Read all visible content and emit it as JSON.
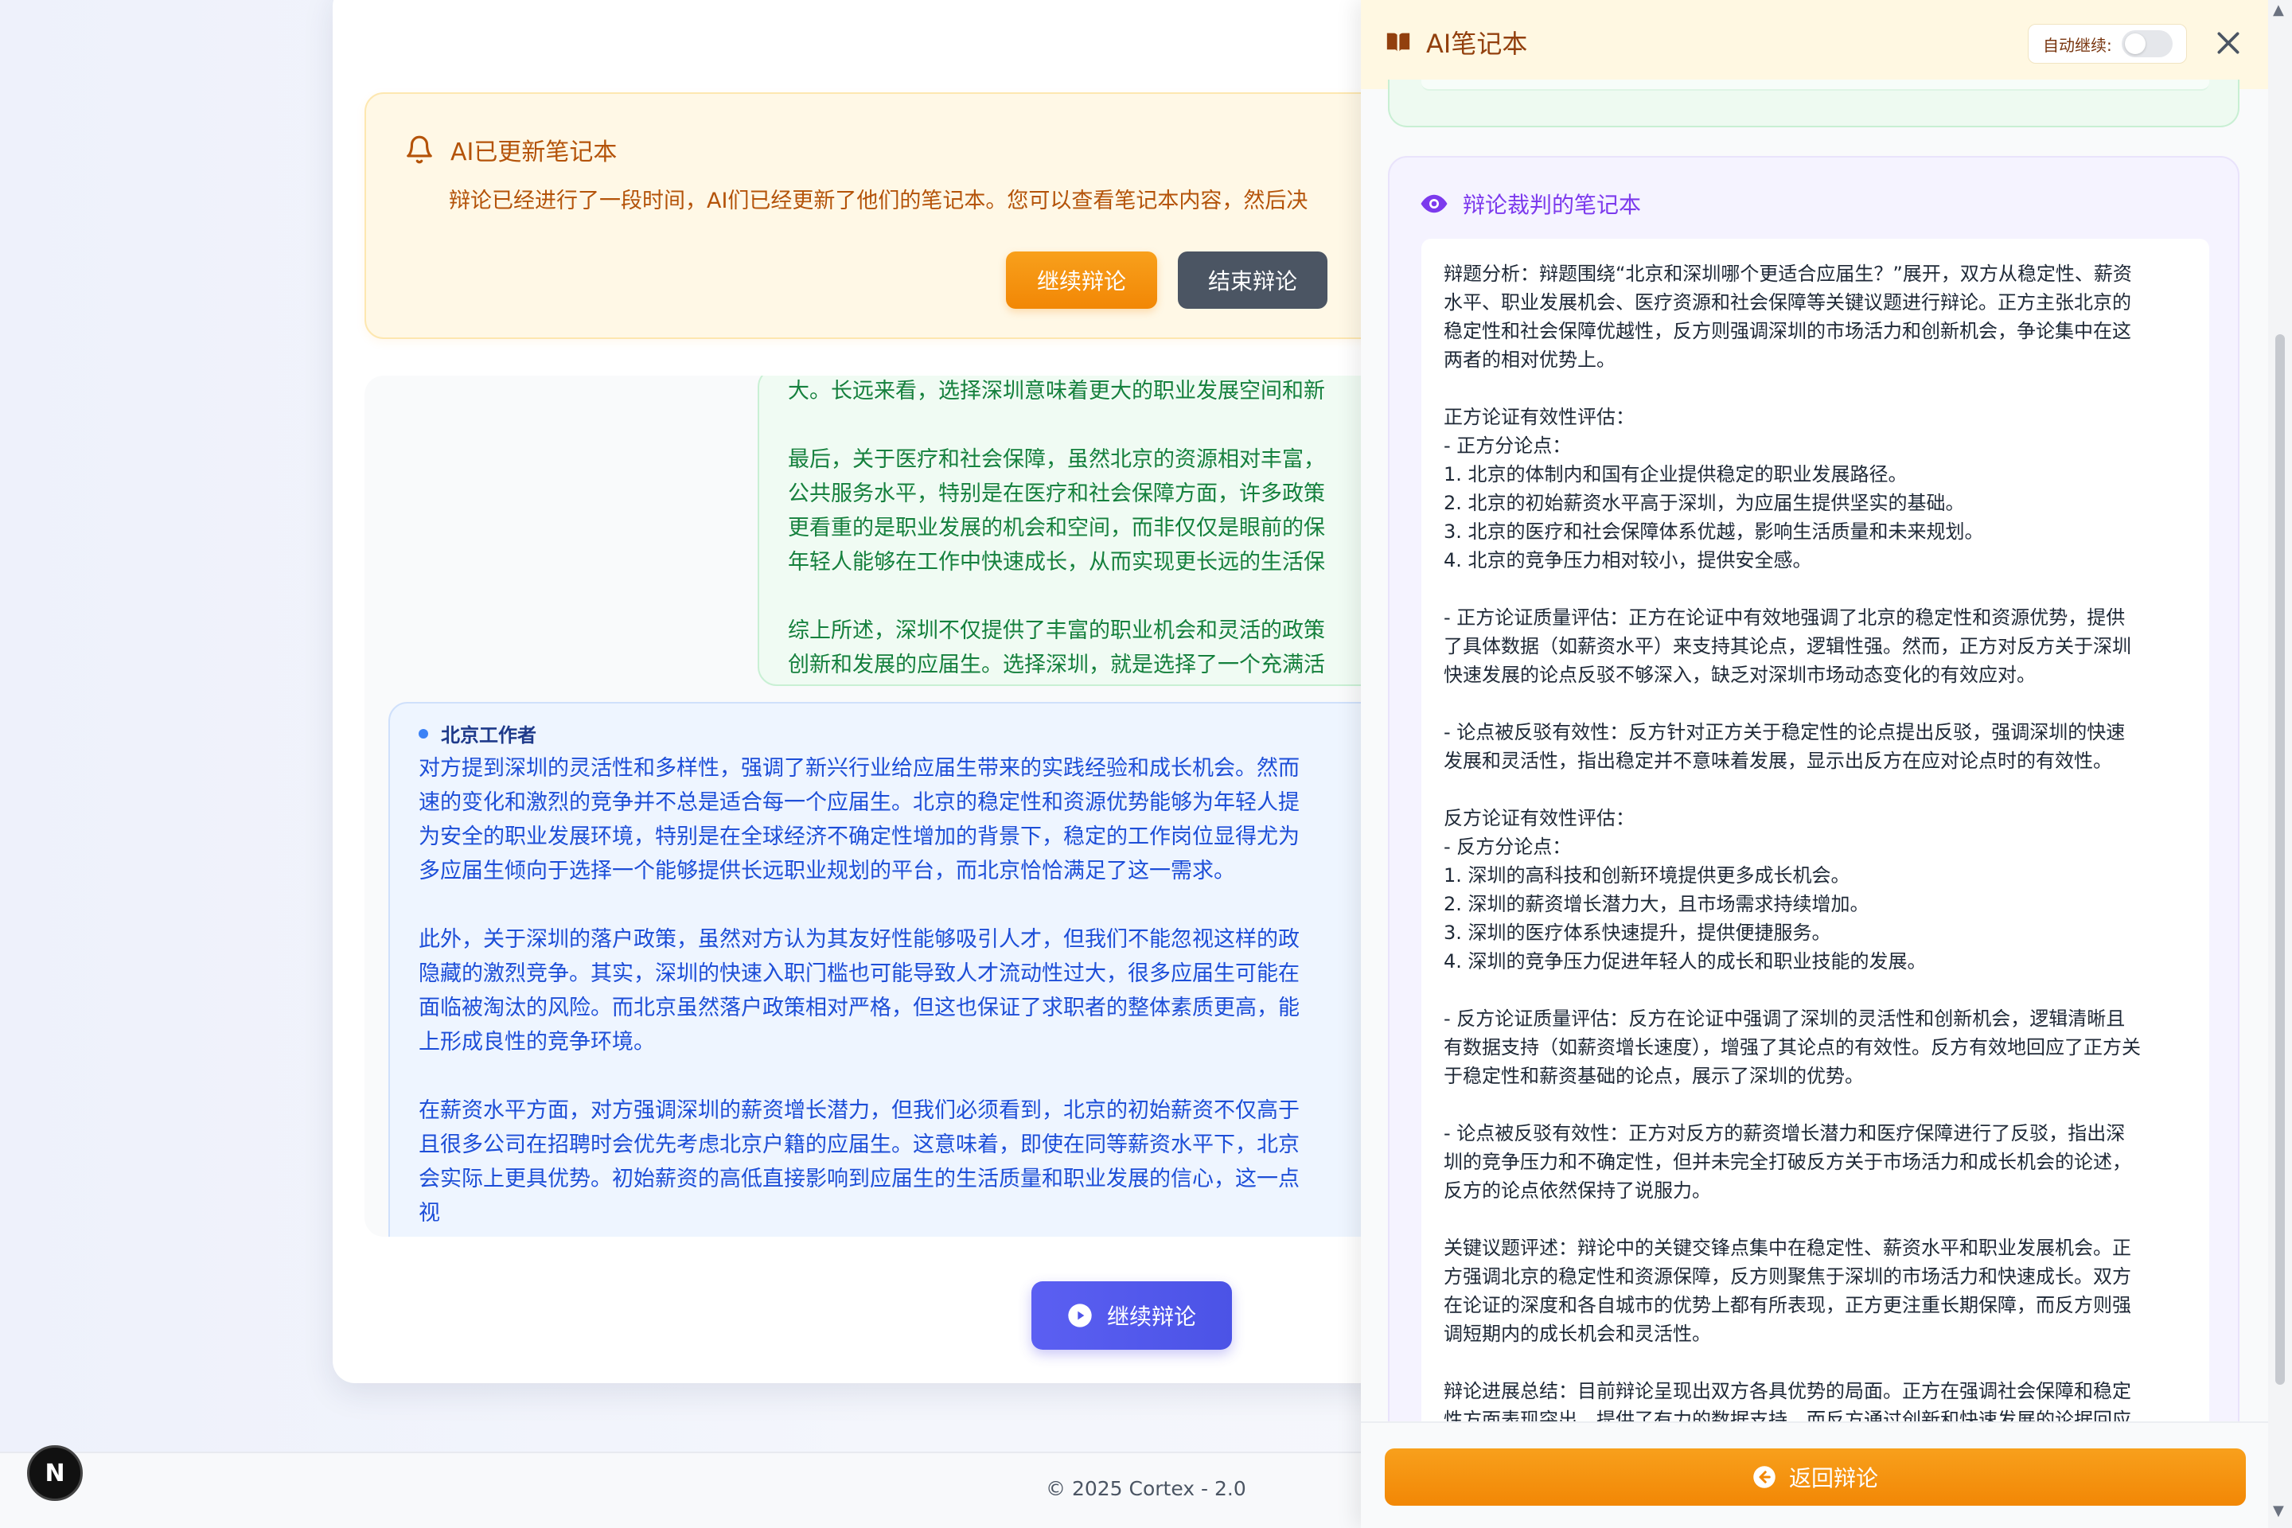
{
  "notice": {
    "title": "AI已更新笔记本",
    "text": "辩论已经进行了一段时间，AI们已经更新了他们的笔记本。您可以查看笔记本内容，然后决",
    "continue_label": "继续辩论",
    "end_label": "结束辩论"
  },
  "messages": {
    "shenzhen": {
      "lines": [
        "大。长远来看，选择深圳意味着更大的职业发展空间和新",
        "最后，关于医疗和社会保障，虽然北京的资源相对丰富，",
        "公共服务水平，特别是在医疗和社会保障方面，许多政策",
        "更看重的是职业发展的机会和空间，而非仅仅是眼前的保",
        "年轻人能够在工作中快速成长，从而实现更长远的生活保",
        "综上所述，深圳不仅提供了丰富的职业机会和灵活的政策",
        "创新和发展的应届生。选择深圳，就是选择了一个充满活"
      ]
    },
    "beijing": {
      "speaker": "北京工作者",
      "lines": [
        "对方提到深圳的灵活性和多样性，强调了新兴行业给应届生带来的实践经验和成长机会。然而",
        "速的变化和激烈的竞争并不总是适合每一个应届生。北京的稳定性和资源优势能够为年轻人提",
        "为安全的职业发展环境，特别是在全球经济不确定性增加的背景下，稳定的工作岗位显得尤为",
        "多应届生倾向于选择一个能够提供长远职业规划的平台，而北京恰恰满足了这一需求。",
        "此外，关于深圳的落户政策，虽然对方认为其友好性能够吸引人才，但我们不能忽视这样的政",
        "隐藏的激烈竞争。其实，深圳的快速入职门槛也可能导致人才流动性过大，很多应届生可能在",
        "面临被淘汰的风险。而北京虽然落户政策相对严格，但这也保证了求职者的整体素质更高，能",
        "上形成良性的竞争环境。",
        "在薪资水平方面，对方强调深圳的薪资增长潜力，但我们必须看到，北京的初始薪资不仅高于",
        "且很多公司在招聘时会优先考虑北京户籍的应届生。这意味着，即使在同等薪资水平下，北京",
        "会实际上更具优势。初始薪资的高低直接影响到应届生的生活质量和职业发展的信心，这一点",
        "视"
      ]
    }
  },
  "play_button_label": "继续辩论",
  "footer": "© 2025 Cortex - 2.0",
  "badge": "N",
  "panel": {
    "title": "AI笔记本",
    "auto_label": "自动继续:",
    "judge_title": "辩论裁判的笔记本",
    "judge_lines": [
      "辩题分析：辩题围绕“北京和深圳哪个更适合应届生？”展开，双方从稳定性、薪资",
      "水平、职业发展机会、医疗资源和社会保障等关键议题进行辩论。正方主张北京的",
      "稳定性和社会保障优越性，反方则强调深圳的市场活力和创新机会，争论集中在这",
      "两者的相对优势上。",
      "",
      "正方论证有效性评估：",
      "- 正方分论点：",
      "  1. 北京的体制内和国有企业提供稳定的职业发展路径。",
      "  2. 北京的初始薪资水平高于深圳，为应届生提供坚实的基础。",
      "  3. 北京的医疗和社会保障体系优越，影响生活质量和未来规划。",
      "  4. 北京的竞争压力相对较小，提供安全感。",
      "",
      "- 正方论证质量评估：正方在论证中有效地强调了北京的稳定性和资源优势，提供",
      "了具体数据（如薪资水平）来支持其论点，逻辑性强。然而，正方对反方关于深圳",
      "快速发展的论点反驳不够深入，缺乏对深圳市场动态变化的有效应对。",
      "",
      "- 论点被反驳有效性：反方针对正方关于稳定性的论点提出反驳，强调深圳的快速",
      "发展和灵活性，指出稳定并不意味着发展，显示出反方在应对论点时的有效性。",
      "",
      "反方论证有效性评估：",
      "- 反方分论点：",
      "  1. 深圳的高科技和创新环境提供更多成长机会。",
      "  2. 深圳的薪资增长潜力大，且市场需求持续增加。",
      "  3. 深圳的医疗体系快速提升，提供便捷服务。",
      "  4. 深圳的竞争压力促进年轻人的成长和职业技能的发展。",
      "",
      "- 反方论证质量评估：反方在论证中强调了深圳的灵活性和创新机会，逻辑清晰且",
      "有数据支持（如薪资增长速度），增强了其论点的有效性。反方有效地回应了正方关",
      "于稳定性和薪资基础的论点，展示了深圳的优势。",
      "",
      "- 论点被反驳有效性：正方对反方的薪资增长潜力和医疗保障进行了反驳，指出深",
      "圳的竞争压力和不确定性，但并未完全打破反方关于市场活力和成长机会的论述，",
      "反方的论点依然保持了说服力。",
      "",
      "关键议题评述：辩论中的关键交锋点集中在稳定性、薪资水平和职业发展机会。正",
      "方强调北京的稳定性和资源保障，反方则聚焦于深圳的市场活力和快速成长。双方",
      "在论证的深度和各自城市的优势上都有所表现，正方更注重长期保障，而反方则强",
      "调短期内的成长机会和灵活性。",
      "",
      "辩论进展总结：目前辩论呈现出双方各具优势的局面。正方在强调社会保障和稳定",
      "性方面表现突出，提供了有力的数据支持，而反方通过创新和快速发展的论据回应"
    ],
    "return_label": "返回辩论"
  }
}
